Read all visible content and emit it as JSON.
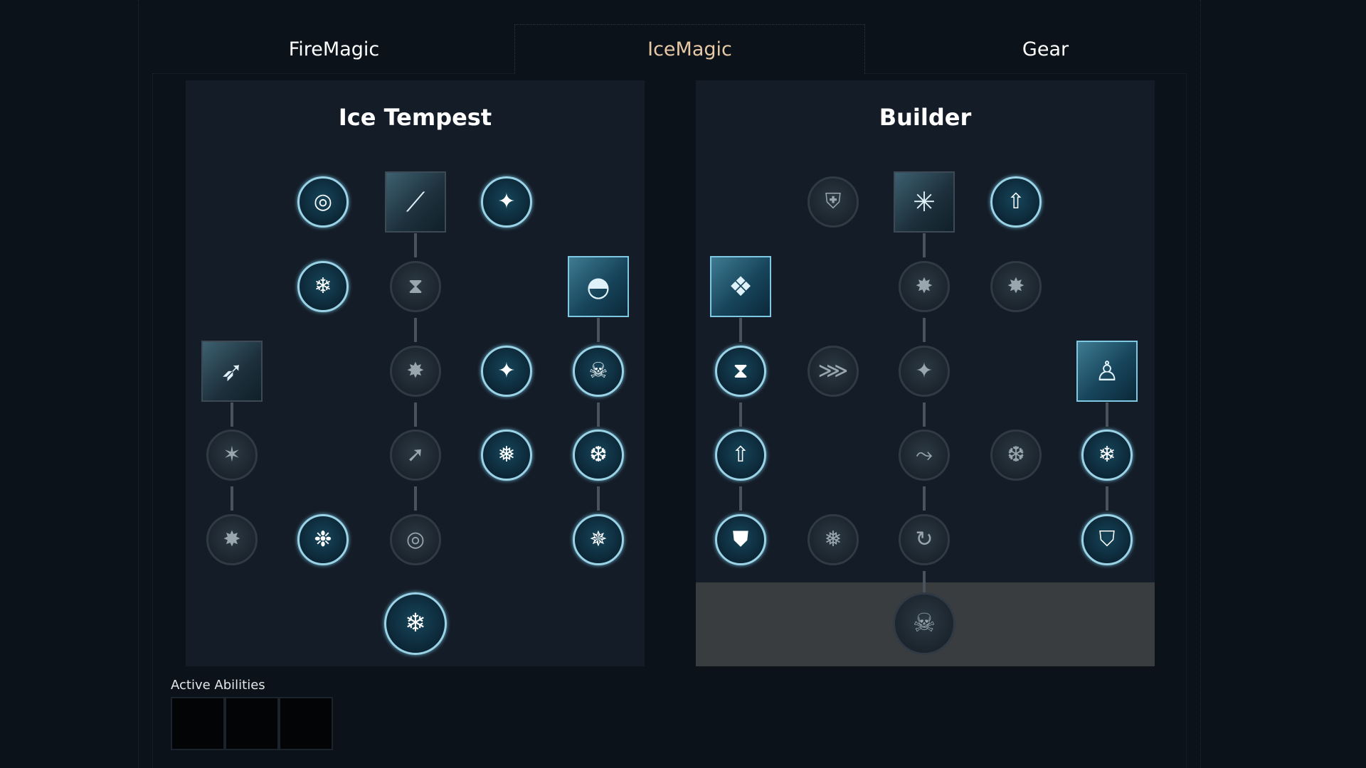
{
  "tabs": [
    {
      "label": "FireMagic",
      "active": false
    },
    {
      "label": "IceMagic",
      "active": true
    },
    {
      "label": "Gear",
      "active": false
    }
  ],
  "colors": {
    "active_tab_text": "#e7c9a6",
    "tab_text": "#ffffff",
    "lit_border": "#9ad2e6",
    "panel_bg": "#141c27"
  },
  "trees": [
    {
      "title": "Ice Tempest",
      "nodes": [
        {
          "id": "ring-spin",
          "icon": "ring-spin-icon",
          "glyph": "◎",
          "state": "lit",
          "shape": "circle"
        },
        {
          "id": "ice-shards",
          "icon": "ice-shards-icon",
          "glyph": "⟋",
          "state": "dim",
          "shape": "square"
        },
        {
          "id": "star-plus",
          "icon": "star-plus-icon",
          "glyph": "✦",
          "state": "lit",
          "shape": "circle"
        },
        {
          "id": "snowflake-down",
          "icon": "snowflake-down-icon",
          "glyph": "❄",
          "state": "lit",
          "shape": "circle"
        },
        {
          "id": "hourglass-down",
          "icon": "hourglass-down-icon",
          "glyph": "⧗",
          "state": "dim",
          "shape": "circle"
        },
        {
          "id": "ice-dome",
          "icon": "ice-dome-icon",
          "glyph": "◓",
          "state": "lit",
          "shape": "square"
        },
        {
          "id": "ice-lance",
          "icon": "ice-lance-icon",
          "glyph": "➶",
          "state": "dim",
          "shape": "square"
        },
        {
          "id": "burst-up",
          "icon": "burst-up-icon",
          "glyph": "✸",
          "state": "dim",
          "shape": "circle"
        },
        {
          "id": "star-chevron",
          "icon": "star-chevron-icon",
          "glyph": "✦",
          "state": "lit",
          "shape": "circle"
        },
        {
          "id": "skull-hourglass",
          "icon": "skull-hourglass-icon",
          "glyph": "☠",
          "state": "lit",
          "shape": "circle"
        },
        {
          "id": "snowflake-star",
          "icon": "snowflake-star-icon",
          "glyph": "✶",
          "state": "dim",
          "shape": "circle"
        },
        {
          "id": "arrow-up-right",
          "icon": "arrow-up-right-icon",
          "glyph": "➚",
          "state": "dim",
          "shape": "circle"
        },
        {
          "id": "snowflake",
          "icon": "snowflake-icon",
          "glyph": "❅",
          "state": "lit",
          "shape": "circle"
        },
        {
          "id": "snowflake-arch",
          "icon": "snowflake-arch-icon",
          "glyph": "❆",
          "state": "lit",
          "shape": "circle"
        },
        {
          "id": "burst-arrow",
          "icon": "burst-arrow-icon",
          "glyph": "✸",
          "state": "dim",
          "shape": "circle"
        },
        {
          "id": "snowflake-cross",
          "icon": "snowflake-cross-icon",
          "glyph": "✵",
          "state": "lit",
          "shape": "circle"
        },
        {
          "id": "ring-spin-dim",
          "icon": "ring-spin-icon",
          "glyph": "◎",
          "state": "dim",
          "shape": "circle"
        },
        {
          "id": "snowflake-badge",
          "icon": "snowflake-badge-icon",
          "glyph": "❉",
          "state": "lit",
          "shape": "circle"
        },
        {
          "id": "ring-snowflake",
          "icon": "ring-snowflake-icon",
          "glyph": "❄",
          "state": "lit",
          "shape": "circle"
        }
      ]
    },
    {
      "title": "Builder",
      "nodes": [
        {
          "id": "shield-axe",
          "icon": "shield-axe-icon",
          "glyph": "⛨",
          "state": "dim",
          "shape": "circle"
        },
        {
          "id": "ice-spire",
          "icon": "ice-spire-icon",
          "glyph": "✳",
          "state": "dim",
          "shape": "square"
        },
        {
          "id": "boot-up",
          "icon": "boot-up-icon",
          "glyph": "⇧",
          "state": "lit",
          "shape": "circle"
        },
        {
          "id": "ice-shatter",
          "icon": "ice-shatter-icon",
          "glyph": "❖",
          "state": "lit",
          "shape": "square"
        },
        {
          "id": "burst-up-1",
          "icon": "burst-up-icon",
          "glyph": "✸",
          "state": "dim",
          "shape": "circle"
        },
        {
          "id": "burst-up-2",
          "icon": "burst-up-icon",
          "glyph": "✸",
          "state": "dim",
          "shape": "circle"
        },
        {
          "id": "hourglass-up",
          "icon": "hourglass-up-icon",
          "glyph": "⧗",
          "state": "lit",
          "shape": "circle"
        },
        {
          "id": "dash",
          "icon": "dash-icon",
          "glyph": "⋙",
          "state": "dim",
          "shape": "circle"
        },
        {
          "id": "star-plus-dim",
          "icon": "star-plus-icon",
          "glyph": "✦",
          "state": "dim",
          "shape": "circle"
        },
        {
          "id": "frost-figure",
          "icon": "frost-figure-icon",
          "glyph": "♙",
          "state": "lit",
          "shape": "square"
        },
        {
          "id": "boot-up-2",
          "icon": "boot-up-icon",
          "glyph": "⇧",
          "state": "lit",
          "shape": "circle"
        },
        {
          "id": "slide",
          "icon": "slide-icon",
          "glyph": "⤳",
          "state": "dim",
          "shape": "circle"
        },
        {
          "id": "snowflake-ring",
          "icon": "snowflake-ring-icon",
          "glyph": "❆",
          "state": "dim",
          "shape": "circle"
        },
        {
          "id": "snowflake-shield",
          "icon": "snowflake-shield-icon",
          "glyph": "❄",
          "state": "lit",
          "shape": "circle"
        },
        {
          "id": "armor",
          "icon": "armor-icon",
          "glyph": "⛊",
          "state": "lit",
          "shape": "circle"
        },
        {
          "id": "snowflake-house",
          "icon": "snowflake-house-icon",
          "glyph": "❅",
          "state": "dim",
          "shape": "circle"
        },
        {
          "id": "cycle-arrow",
          "icon": "cycle-arrow-icon",
          "glyph": "↻",
          "state": "dim",
          "shape": "circle"
        },
        {
          "id": "shield-sparkle",
          "icon": "shield-sparkle-icon",
          "glyph": "⛉",
          "state": "lit",
          "shape": "circle"
        },
        {
          "id": "skull-snowflake",
          "icon": "skull-snowflake-icon",
          "glyph": "☠",
          "state": "dim",
          "shape": "circle"
        }
      ]
    }
  ],
  "active_abilities": {
    "label": "Active Abilities",
    "slots": 3
  }
}
